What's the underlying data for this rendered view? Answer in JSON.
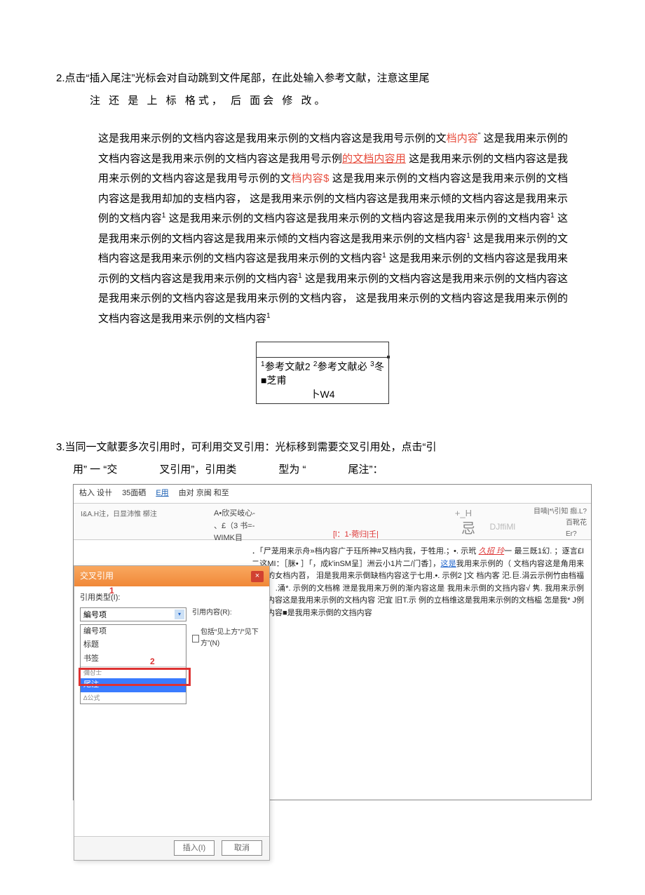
{
  "step2": {
    "heading": "2.点击“插入尾注”光标会对自动跳到文件尾部，在此处输入参考文献，注意这里尾",
    "sub": "注 还 是 上 标 格式， 后 面会 修 改。"
  },
  "doc_paragraph": {
    "t1": "这是我用来示例的文档内容这是我用来示例的文档内容这是我用号示例的文",
    "r1": "档内容",
    "t2": "这是我用来示例的文档内容这是我用来示例的文档内容这是我用号示例",
    "r2": "的文档内容用",
    "t3": "这是我用来示例的文档内容这是我用来示例的文档内容这是我用号示例的文",
    "r3": "档内容$",
    "t4": "这是我用来示例的文档内容这是我用来示例的文档内容这是我用却加的支档内容， 这是我用来示例的文档内容这是我用来示倾的文档内容这是我用来示例的文档内容",
    "t5": "这是我用来示例的文档内容这是我用来示例的文档内容这是我用来示例的文档内容",
    "t6": "这是我用来示例的文档内容这是我用来示倾的文档内容这是我用来示例的文档内容",
    "t7": "这是我用来示例的文档内容这是我用来示例的文档内容这是我用来示例的文档内容",
    "t8": "这是我用来示例的文档内容这是我用来示例的文档内容这是我用来示例的文档内容",
    "t9": "这是我用来示例的文档内容这是我用来示例的文档内容这是我用来示例的文档内容这是我用来示例的文档内容， 这是我用来示例的文档内容这是我用来示例的文档内容这是我用来示例的文档内容"
  },
  "footnote_box": {
    "line1": "参考文献2 ",
    "line2": "参考文献必 ",
    "line3": "冬■芝甫",
    "line4": "卜W4",
    "s1": "1",
    "s2": "2",
    "s3": "3"
  },
  "step3": {
    "heading": "3.当同一文献要多次引用时，可利用交叉引用：光标移到需要交叉引用处，点击“引",
    "p1": "用” 一 “交",
    "p2": "叉引用”，引用类",
    "p3": "型为 “",
    "p4": "尾注”："
  },
  "word_ui": {
    "tabs": {
      "t1": "枯入  设卄",
      "t2": "35面硒",
      "t3": "E用",
      "t4": "由对  京闽  和至"
    },
    "ribbon": {
      "left": "I&A.H注，日显沛惟 槨注",
      "center_top": "A•欣买岐心-",
      "center_mid": "、£（3 书=-",
      "center_bot": "WIMK目",
      "red_link": "[l：1-菀归|壬|",
      "right_h": "+_H",
      "right_ji": "忌",
      "right_dj": "DJffiMl",
      "far1": "目喃|*\\引知 痂.L?",
      "far2": "百靴花",
      "far3": "Er?"
    },
    "body_text": {
      "l1": "．「尸茏用来示舟»档内容广于珏所神#又档内我，于牲用.；•. 示玳 ",
      "l1r": "久招 玲",
      "l1e": "一 最三既1幻.",
      "l2": "；逐言£I二这MI：［脒• ］「，成k'inSM呈］洲云小1片二/门香］，",
      "l2b": "这是",
      "l2e": "我用来示例的（",
      "l3": "文档内容这是角用来示别的女档内苕， 泪是我用来示倒缺档内容这亍七用.•. 示例2 ]文",
      "l4": "档内客 汜.巨.涓云示例竹由档福这是］.涌*. 示例的文档棉 泄是我用来万例的渐内容这是",
      "l5": "我用未示倒的文挡内容√ 隽. 我用来示例於档内容这是我用来示例的文档内容 汜宜 旧T.示",
      "l6": "例的立档维这是我用来示例的文档榀 怎是我*  J例的渐内容■是我用来示倒的文挡内容"
    },
    "dialog": {
      "title": "交叉引用",
      "label_type": "引用类型(I):",
      "select_value": "編号项",
      "list_items": [
        "编号项",
        "标题",
        "书签",
        "尾注"
      ],
      "small_item_top": "彌삼士",
      "small_item_bot": "∆公式",
      "selected": "尾注",
      "link_label": "引用内容(R):",
      "checkbox_label": "包括“见上方”/“见下方”(N)",
      "btn_insert": "插入(I)",
      "btn_cancel": "取消",
      "red_num_1": "1",
      "red_num_2": "2"
    }
  }
}
